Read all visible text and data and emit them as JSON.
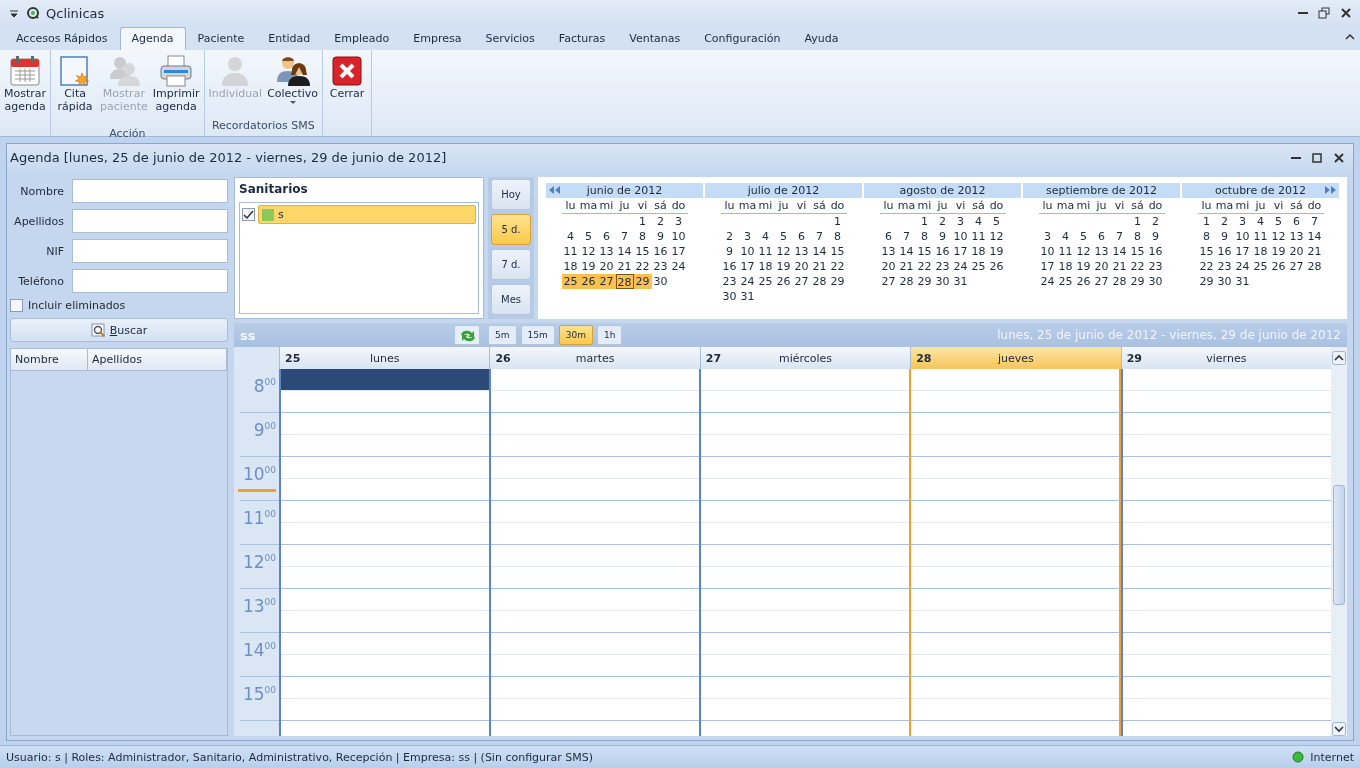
{
  "window": {
    "title": "Qclinicas"
  },
  "tabs": [
    {
      "label": "Accesos Rápidos",
      "selected": false
    },
    {
      "label": "Agenda",
      "selected": true
    },
    {
      "label": "Paciente",
      "selected": false
    },
    {
      "label": "Entidad",
      "selected": false
    },
    {
      "label": "Empleado",
      "selected": false
    },
    {
      "label": "Empresa",
      "selected": false
    },
    {
      "label": "Servicios",
      "selected": false
    },
    {
      "label": "Facturas",
      "selected": false
    },
    {
      "label": "Ventanas",
      "selected": false
    },
    {
      "label": "Configuración",
      "selected": false
    },
    {
      "label": "Ayuda",
      "selected": false
    }
  ],
  "ribbon": {
    "groups": [
      {
        "buttons": [
          {
            "label": "Mostrar\nagenda",
            "disabled": false,
            "dropdown": false
          }
        ]
      },
      {
        "label": "Acción",
        "buttons": [
          {
            "label": "Cita\nrápida",
            "disabled": false,
            "dropdown": false
          },
          {
            "label": "Mostrar\npaciente",
            "disabled": true,
            "dropdown": false
          },
          {
            "label": "Imprimir\nagenda",
            "disabled": false,
            "dropdown": false
          }
        ]
      },
      {
        "label": "Recordatorios SMS",
        "buttons": [
          {
            "label": "Individual",
            "disabled": true,
            "dropdown": false
          },
          {
            "label": "Colectivo",
            "disabled": false,
            "dropdown": true
          }
        ]
      },
      {
        "buttons": [
          {
            "label": "Cerrar",
            "disabled": false,
            "dropdown": false
          }
        ]
      }
    ]
  },
  "agenda": {
    "title": "Agenda [lunes, 25 de junio de 2012 - viernes, 29 de junio de 2012]",
    "search": {
      "fields": [
        {
          "label": "Nombre"
        },
        {
          "label": "Apellidos"
        },
        {
          "label": "NIF"
        },
        {
          "label": "Teléfono"
        }
      ],
      "include_deleted": {
        "label": "Incluir eliminados",
        "checked": false
      },
      "button": "Buscar",
      "columns": [
        "Nombre",
        "Apellidos"
      ]
    },
    "staff": {
      "title": "Sanitarios",
      "items": [
        {
          "label": "s",
          "checked": true,
          "selected": true,
          "color": "#8cc85a"
        }
      ]
    },
    "views": [
      {
        "label": "Hoy",
        "selected": false
      },
      {
        "label": "5 d.",
        "selected": true
      },
      {
        "label": "7 d.",
        "selected": false
      },
      {
        "label": "Mes",
        "selected": false
      }
    ],
    "months": [
      {
        "title": "junio de 2012",
        "weekdays": [
          "lu",
          "ma",
          "mi",
          "ju",
          "vi",
          "sá",
          "do"
        ],
        "weeks": [
          [
            {
              "day": "1",
              "selected": false,
              "today": false
            },
            {
              "day": "2",
              "selected": false,
              "today": false
            },
            {
              "day": "3",
              "selected": false,
              "today": false
            }
          ],
          [
            {
              "day": "4",
              "selected": false,
              "today": false
            },
            {
              "day": "5",
              "selected": false,
              "today": false
            },
            {
              "day": "6",
              "selected": false,
              "today": false
            },
            {
              "day": "7",
              "selected": false,
              "today": false
            },
            {
              "day": "8",
              "selected": false,
              "today": false
            },
            {
              "day": "9",
              "selected": false,
              "today": false
            },
            {
              "day": "10",
              "selected": false,
              "today": false
            }
          ],
          [
            {
              "day": "11",
              "selected": false,
              "today": false
            },
            {
              "day": "12",
              "selected": false,
              "today": false
            },
            {
              "day": "13",
              "selected": false,
              "today": false
            },
            {
              "day": "14",
              "selected": false,
              "today": false
            },
            {
              "day": "15",
              "selected": false,
              "today": false
            },
            {
              "day": "16",
              "selected": false,
              "today": false
            },
            {
              "day": "17",
              "selected": false,
              "today": false
            }
          ],
          [
            {
              "day": "18",
              "selected": false,
              "today": false
            },
            {
              "day": "19",
              "selected": false,
              "today": false
            },
            {
              "day": "20",
              "selected": false,
              "today": false
            },
            {
              "day": "21",
              "selected": false,
              "today": false
            },
            {
              "day": "22",
              "selected": false,
              "today": false
            },
            {
              "day": "23",
              "selected": false,
              "today": false
            },
            {
              "day": "24",
              "selected": false,
              "today": false
            }
          ],
          [
            {
              "day": "25",
              "selected": true,
              "today": false
            },
            {
              "day": "26",
              "selected": true,
              "today": false
            },
            {
              "day": "27",
              "selected": true,
              "today": false
            },
            {
              "day": "28",
              "selected": true,
              "today": true
            },
            {
              "day": "29",
              "selected": true,
              "today": false
            },
            {
              "day": "30",
              "selected": false,
              "today": false
            }
          ]
        ]
      },
      {
        "title": "julio de 2012",
        "weekdays": [
          "lu",
          "ma",
          "mi",
          "ju",
          "vi",
          "sá",
          "do"
        ],
        "weeks": [
          [
            {
              "day": "1",
              "selected": false,
              "today": false
            }
          ],
          [
            {
              "day": "2",
              "selected": false,
              "today": false
            },
            {
              "day": "3",
              "selected": false,
              "today": false
            },
            {
              "day": "4",
              "selected": false,
              "today": false
            },
            {
              "day": "5",
              "selected": false,
              "today": false
            },
            {
              "day": "6",
              "selected": false,
              "today": false
            },
            {
              "day": "7",
              "selected": false,
              "today": false
            },
            {
              "day": "8",
              "selected": false,
              "today": false
            }
          ],
          [
            {
              "day": "9",
              "selected": false,
              "today": false
            },
            {
              "day": "10",
              "selected": false,
              "today": false
            },
            {
              "day": "11",
              "selected": false,
              "today": false
            },
            {
              "day": "12",
              "selected": false,
              "today": false
            },
            {
              "day": "13",
              "selected": false,
              "today": false
            },
            {
              "day": "14",
              "selected": false,
              "today": false
            },
            {
              "day": "15",
              "selected": false,
              "today": false
            }
          ],
          [
            {
              "day": "16",
              "selected": false,
              "today": false
            },
            {
              "day": "17",
              "selected": false,
              "today": false
            },
            {
              "day": "18",
              "selected": false,
              "today": false
            },
            {
              "day": "19",
              "selected": false,
              "today": false
            },
            {
              "day": "20",
              "selected": false,
              "today": false
            },
            {
              "day": "21",
              "selected": false,
              "today": false
            },
            {
              "day": "22",
              "selected": false,
              "today": false
            }
          ],
          [
            {
              "day": "23",
              "selected": false,
              "today": false
            },
            {
              "day": "24",
              "selected": false,
              "today": false
            },
            {
              "day": "25",
              "selected": false,
              "today": false
            },
            {
              "day": "26",
              "selected": false,
              "today": false
            },
            {
              "day": "27",
              "selected": false,
              "today": false
            },
            {
              "day": "28",
              "selected": false,
              "today": false
            },
            {
              "day": "29",
              "selected": false,
              "today": false
            }
          ],
          [
            {
              "day": "30",
              "selected": false,
              "today": false
            },
            {
              "day": "31",
              "selected": false,
              "today": false
            }
          ]
        ]
      },
      {
        "title": "agosto de 2012",
        "weekdays": [
          "lu",
          "ma",
          "mi",
          "ju",
          "vi",
          "sá",
          "do"
        ],
        "weeks": [
          [
            {
              "day": "1",
              "selected": false,
              "today": false
            },
            {
              "day": "2",
              "selected": false,
              "today": false
            },
            {
              "day": "3",
              "selected": false,
              "today": false
            },
            {
              "day": "4",
              "selected": false,
              "today": false
            },
            {
              "day": "5",
              "selected": false,
              "today": false
            }
          ],
          [
            {
              "day": "6",
              "selected": false,
              "today": false
            },
            {
              "day": "7",
              "selected": false,
              "today": false
            },
            {
              "day": "8",
              "selected": false,
              "today": false
            },
            {
              "day": "9",
              "selected": false,
              "today": false
            },
            {
              "day": "10",
              "selected": false,
              "today": false
            },
            {
              "day": "11",
              "selected": false,
              "today": false
            },
            {
              "day": "12",
              "selected": false,
              "today": false
            }
          ],
          [
            {
              "day": "13",
              "selected": false,
              "today": false
            },
            {
              "day": "14",
              "selected": false,
              "today": false
            },
            {
              "day": "15",
              "selected": false,
              "today": false
            },
            {
              "day": "16",
              "selected": false,
              "today": false
            },
            {
              "day": "17",
              "selected": false,
              "today": false
            },
            {
              "day": "18",
              "selected": false,
              "today": false
            },
            {
              "day": "19",
              "selected": false,
              "today": false
            }
          ],
          [
            {
              "day": "20",
              "selected": false,
              "today": false
            },
            {
              "day": "21",
              "selected": false,
              "today": false
            },
            {
              "day": "22",
              "selected": false,
              "today": false
            },
            {
              "day": "23",
              "selected": false,
              "today": false
            },
            {
              "day": "24",
              "selected": false,
              "today": false
            },
            {
              "day": "25",
              "selected": false,
              "today": false
            },
            {
              "day": "26",
              "selected": false,
              "today": false
            }
          ],
          [
            {
              "day": "27",
              "selected": false,
              "today": false
            },
            {
              "day": "28",
              "selected": false,
              "today": false
            },
            {
              "day": "29",
              "selected": false,
              "today": false
            },
            {
              "day": "30",
              "selected": false,
              "today": false
            },
            {
              "day": "31",
              "selected": false,
              "today": false
            }
          ]
        ]
      },
      {
        "title": "septiembre de 2012",
        "weekdays": [
          "lu",
          "ma",
          "mi",
          "ju",
          "vi",
          "sá",
          "do"
        ],
        "weeks": [
          [
            {
              "day": "1",
              "selected": false,
              "today": false
            },
            {
              "day": "2",
              "selected": false,
              "today": false
            }
          ],
          [
            {
              "day": "3",
              "selected": false,
              "today": false
            },
            {
              "day": "4",
              "selected": false,
              "today": false
            },
            {
              "day": "5",
              "selected": false,
              "today": false
            },
            {
              "day": "6",
              "selected": false,
              "today": false
            },
            {
              "day": "7",
              "selected": false,
              "today": false
            },
            {
              "day": "8",
              "selected": false,
              "today": false
            },
            {
              "day": "9",
              "selected": false,
              "today": false
            }
          ],
          [
            {
              "day": "10",
              "selected": false,
              "today": false
            },
            {
              "day": "11",
              "selected": false,
              "today": false
            },
            {
              "day": "12",
              "selected": false,
              "today": false
            },
            {
              "day": "13",
              "selected": false,
              "today": false
            },
            {
              "day": "14",
              "selected": false,
              "today": false
            },
            {
              "day": "15",
              "selected": false,
              "today": false
            },
            {
              "day": "16",
              "selected": false,
              "today": false
            }
          ],
          [
            {
              "day": "17",
              "selected": false,
              "today": false
            },
            {
              "day": "18",
              "selected": false,
              "today": false
            },
            {
              "day": "19",
              "selected": false,
              "today": false
            },
            {
              "day": "20",
              "selected": false,
              "today": false
            },
            {
              "day": "21",
              "selected": false,
              "today": false
            },
            {
              "day": "22",
              "selected": false,
              "today": false
            },
            {
              "day": "23",
              "selected": false,
              "today": false
            }
          ],
          [
            {
              "day": "24",
              "selected": false,
              "today": false
            },
            {
              "day": "25",
              "selected": false,
              "today": false
            },
            {
              "day": "26",
              "selected": false,
              "today": false
            },
            {
              "day": "27",
              "selected": false,
              "today": false
            },
            {
              "day": "28",
              "selected": false,
              "today": false
            },
            {
              "day": "29",
              "selected": false,
              "today": false
            },
            {
              "day": "30",
              "selected": false,
              "today": false
            }
          ]
        ]
      },
      {
        "title": "octubre de 2012",
        "weekdays": [
          "lu",
          "ma",
          "mi",
          "ju",
          "vi",
          "sá",
          "do"
        ],
        "weeks": [
          [
            {
              "day": "1",
              "selected": false,
              "today": false
            },
            {
              "day": "2",
              "selected": false,
              "today": false
            },
            {
              "day": "3",
              "selected": false,
              "today": false
            },
            {
              "day": "4",
              "selected": false,
              "today": false
            },
            {
              "day": "5",
              "selected": false,
              "today": false
            },
            {
              "day": "6",
              "selected": false,
              "today": false
            },
            {
              "day": "7",
              "selected": false,
              "today": false
            }
          ],
          [
            {
              "day": "8",
              "selected": false,
              "today": false
            },
            {
              "day": "9",
              "selected": false,
              "today": false
            },
            {
              "day": "10",
              "selected": false,
              "today": false
            },
            {
              "day": "11",
              "selected": false,
              "today": false
            },
            {
              "day": "12",
              "selected": false,
              "today": false
            },
            {
              "day": "13",
              "selected": false,
              "today": false
            },
            {
              "day": "14",
              "selected": false,
              "today": false
            }
          ],
          [
            {
              "day": "15",
              "selected": false,
              "today": false
            },
            {
              "day": "16",
              "selected": false,
              "today": false
            },
            {
              "day": "17",
              "selected": false,
              "today": false
            },
            {
              "day": "18",
              "selected": false,
              "today": false
            },
            {
              "day": "19",
              "selected": false,
              "today": false
            },
            {
              "day": "20",
              "selected": false,
              "today": false
            },
            {
              "day": "21",
              "selected": false,
              "today": false
            }
          ],
          [
            {
              "day": "22",
              "selected": false,
              "today": false
            },
            {
              "day": "23",
              "selected": false,
              "today": false
            },
            {
              "day": "24",
              "selected": false,
              "today": false
            },
            {
              "day": "25",
              "selected": false,
              "today": false
            },
            {
              "day": "26",
              "selected": false,
              "today": false
            },
            {
              "day": "27",
              "selected": false,
              "today": false
            },
            {
              "day": "28",
              "selected": false,
              "today": false
            }
          ],
          [
            {
              "day": "29",
              "selected": false,
              "today": false
            },
            {
              "day": "30",
              "selected": false,
              "today": false
            },
            {
              "day": "31",
              "selected": false,
              "today": false
            }
          ]
        ]
      }
    ],
    "scheduler": {
      "resource": "ss",
      "intervals": [
        {
          "label": "5m",
          "selected": false
        },
        {
          "label": "15m",
          "selected": false
        },
        {
          "label": "30m",
          "selected": true
        },
        {
          "label": "1h",
          "selected": false
        }
      ],
      "range": "lunes, 25 de junio de 2012 - viernes, 29 de junio de 2012",
      "days": [
        {
          "number": "25",
          "name": "lunes",
          "today": false,
          "selected": true
        },
        {
          "number": "26",
          "name": "martes",
          "today": false,
          "selected": false
        },
        {
          "number": "27",
          "name": "miércoles",
          "today": false,
          "selected": false
        },
        {
          "number": "28",
          "name": "jueves",
          "today": true,
          "selected": false
        },
        {
          "number": "29",
          "name": "viernes",
          "today": false,
          "selected": false
        }
      ],
      "hours": [
        {
          "label": "8$^{00}$",
          "current": false
        },
        {
          "label": "9$^{00}$",
          "current": false
        },
        {
          "label": "10$^{00}$",
          "current": true
        },
        {
          "label": "11$^{00}$",
          "current": false
        },
        {
          "label": "12$^{00}$",
          "current": false
        },
        {
          "label": "13$^{00}$",
          "current": false
        },
        {
          "label": "14$^{00}$",
          "current": false
        },
        {
          "label": "15$^{00}$",
          "current": false
        }
      ]
    }
  },
  "status_bar": {
    "text": "Usuario: s | Roles: Administrador, Sanitario, Administrativo, Recepción | Empresa: ss | (Sin configurar SMS)",
    "connection": "Internet"
  }
}
